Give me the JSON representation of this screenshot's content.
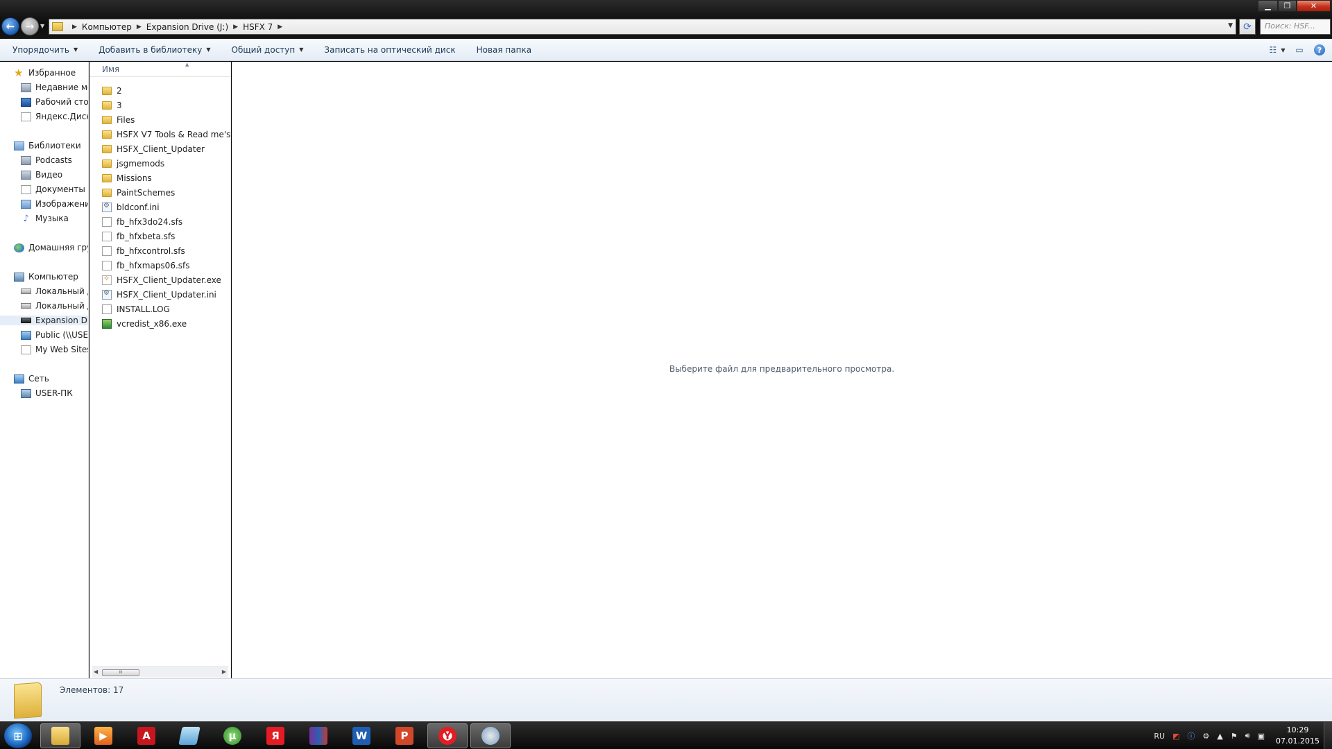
{
  "address": {
    "crumbs": [
      "Компьютер",
      "Expansion Drive (J:)",
      "HSFX 7"
    ],
    "search_placeholder": "Поиск: HSF..."
  },
  "toolbar": {
    "organize": "Упорядочить",
    "add_to_library": "Добавить в библиотеку",
    "share": "Общий доступ",
    "burn": "Записать на оптический диск",
    "new_folder": "Новая папка"
  },
  "nav": {
    "favorites": "Избранное",
    "recent": "Недавние мес",
    "desktop": "Рабочий стол",
    "yandex_disk": "Яндекс.Диск",
    "libraries": "Библиотеки",
    "podcasts": "Podcasts",
    "video": "Видео",
    "documents": "Документы",
    "images": "Изображения",
    "music": "Музыка",
    "homegroup": "Домашняя груп",
    "computer": "Компьютер",
    "local_disk_1": "Локальный ди",
    "local_disk_2": "Локальный ди",
    "expansion_drive": "Expansion Driv",
    "public": "Public (\\\\USER",
    "my_web_sites": "My Web Sites",
    "network": "Сеть",
    "user_pc": "USER-ПК"
  },
  "files": {
    "column_name": "Имя",
    "items": [
      {
        "name": "2",
        "type": "folder"
      },
      {
        "name": "3",
        "type": "folder"
      },
      {
        "name": "Files",
        "type": "folder"
      },
      {
        "name": "HSFX V7 Tools & Read me's",
        "type": "folder"
      },
      {
        "name": "HSFX_Client_Updater",
        "type": "folder"
      },
      {
        "name": "jsgmemods",
        "type": "folder"
      },
      {
        "name": "Missions",
        "type": "folder"
      },
      {
        "name": "PaintSchemes",
        "type": "folder"
      },
      {
        "name": "bldconf.ini",
        "type": "ini"
      },
      {
        "name": "fb_hfx3do24.sfs",
        "type": "sfs"
      },
      {
        "name": "fb_hfxbeta.sfs",
        "type": "sfs"
      },
      {
        "name": "fb_hfxcontrol.sfs",
        "type": "sfs"
      },
      {
        "name": "fb_hfxmaps06.sfs",
        "type": "sfs"
      },
      {
        "name": "HSFX_Client_Updater.exe",
        "type": "exe"
      },
      {
        "name": "HSFX_Client_Updater.ini",
        "type": "ini"
      },
      {
        "name": "INSTALL.LOG",
        "type": "log"
      },
      {
        "name": "vcredist_x86.exe",
        "type": "setup"
      }
    ]
  },
  "preview": {
    "message": "Выберите файл для предварительного просмотра."
  },
  "details": {
    "count": "Элементов: 17"
  },
  "taskbar": {
    "lang": "RU",
    "time": "10:29",
    "date": "07.01.2015",
    "apps": [
      "explorer",
      "media-player",
      "acrobat",
      "notepad",
      "torrent",
      "yandex",
      "winrar",
      "word",
      "powerpoint",
      "yandex-browser",
      "paint"
    ]
  },
  "colors": {
    "toolbar_text": "#1e3956",
    "selection": "#e5eef8",
    "close_button": "#c5321c"
  }
}
